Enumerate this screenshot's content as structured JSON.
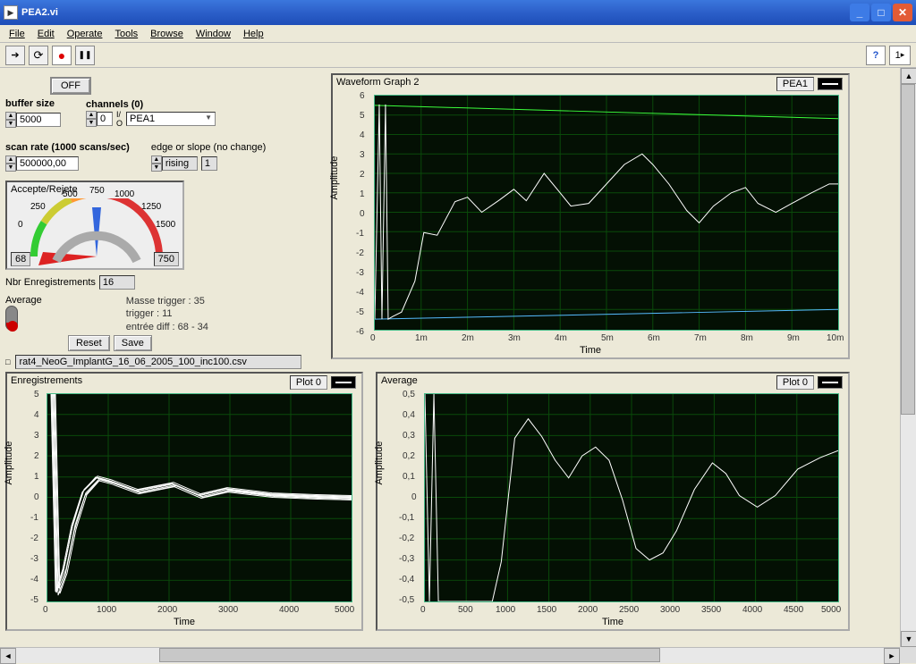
{
  "window": {
    "title": "PEA2.vi"
  },
  "menu": [
    "File",
    "Edit",
    "Operate",
    "Tools",
    "Browse",
    "Window",
    "Help"
  ],
  "toolbar": {
    "context_help": "?",
    "ctx_val": "1"
  },
  "controls": {
    "off_label": "OFF",
    "buffer_size_label": "buffer size",
    "buffer_size": "5000",
    "channels_label": "channels (0)",
    "channels_idx": "0",
    "channels_sel": "PEA1",
    "scan_rate_label": "scan rate (1000 scans/sec)",
    "scan_rate": "500000,00",
    "edge_label": "edge or slope (no change)",
    "edge_sel": "rising",
    "edge_val": "1",
    "gauge_title": "Accepte/Rejete",
    "gauge_ticks": [
      "0",
      "250",
      "500",
      "750",
      "1000",
      "1250",
      "1500"
    ],
    "gauge_left": "68",
    "gauge_right": "750",
    "nbr_label": "Nbr Enregistrements",
    "nbr_val": "16",
    "average_label": "Average",
    "reset_label": "Reset",
    "save_label": "Save",
    "info1": "Masse trigger : 35",
    "info2": "trigger : 11",
    "info3": "entrée diff : 68 - 34",
    "path": "rat4_NeoG_ImplantG_16_06_2005_100_inc100.csv"
  },
  "chart1": {
    "title": "Waveform Graph 2",
    "legend": "PEA1",
    "ylabel": "Amplitude",
    "xlabel": "Time",
    "yticks": [
      "6",
      "5",
      "4",
      "3",
      "2",
      "1",
      "0",
      "-1",
      "-2",
      "-3",
      "-4",
      "-5",
      "-6"
    ],
    "xticks": [
      "0",
      "1m",
      "2m",
      "3m",
      "4m",
      "5m",
      "6m",
      "7m",
      "8m",
      "9m",
      "10m"
    ]
  },
  "chart2": {
    "title": "Enregistrements",
    "legend": "Plot 0",
    "ylabel": "Amplitude",
    "xlabel": "Time",
    "yticks": [
      "5",
      "4",
      "3",
      "2",
      "1",
      "0",
      "-1",
      "-2",
      "-3",
      "-4",
      "-5"
    ],
    "xticks": [
      "0",
      "1000",
      "2000",
      "3000",
      "4000",
      "5000"
    ]
  },
  "chart3": {
    "title": "Average",
    "legend": "Plot 0",
    "ylabel": "Amplitude",
    "xlabel": "Time",
    "yticks": [
      "0,5",
      "0,4",
      "0,3",
      "0,2",
      "0,1",
      "0",
      "-0,1",
      "-0,2",
      "-0,3",
      "-0,4",
      "-0,5"
    ],
    "xticks": [
      "0",
      "500",
      "1000",
      "1500",
      "2000",
      "2500",
      "3000",
      "3500",
      "4000",
      "4500",
      "5000"
    ]
  },
  "chart_data": [
    {
      "type": "line",
      "title": "Waveform Graph 2 — PEA1",
      "xlabel": "Time",
      "ylabel": "Amplitude",
      "xlim": [
        "0",
        "10m"
      ],
      "ylim": [
        -6,
        6
      ],
      "series": [
        {
          "name": "PEA1-white",
          "x": [
            0,
            0.3,
            0.5,
            0.8,
            1.0,
            1.3,
            1.7,
            2.0,
            2.3,
            2.7,
            3.0,
            3.3,
            3.7,
            4.0,
            4.3,
            4.7,
            5.0,
            5.3,
            5.7,
            6.0,
            6.3,
            6.7,
            7.0,
            7.3,
            7.7,
            8.0,
            8.3,
            8.7,
            9.0,
            9.3,
            9.7,
            10.0
          ],
          "y": [
            -5.5,
            -5.3,
            -5.0,
            -3.5,
            -1.0,
            -1.0,
            0.5,
            0.8,
            0.0,
            0.6,
            1.2,
            0.6,
            2.0,
            1.0,
            0.3,
            0.5,
            1.5,
            2.5,
            3.0,
            2.5,
            1.5,
            0.1,
            -0.5,
            0.3,
            1.0,
            1.3,
            0.5,
            0.0,
            0.5,
            1.0,
            1.2,
            1.5
          ]
        },
        {
          "name": "green",
          "x": [
            0,
            10
          ],
          "y": [
            5.5,
            4.8
          ]
        },
        {
          "name": "blue",
          "x": [
            0,
            10
          ],
          "y": [
            -5.5,
            -5.0
          ]
        }
      ]
    },
    {
      "type": "line",
      "title": "Enregistrements (16 overlaid recordings)",
      "xlabel": "Time",
      "ylabel": "Amplitude",
      "xlim": [
        0,
        5000
      ],
      "ylim": [
        -5,
        5
      ],
      "series": [
        {
          "name": "Plot 0 (representative)",
          "x": [
            0,
            100,
            200,
            300,
            400,
            600,
            800,
            1000,
            1500,
            2000,
            2500,
            3000,
            4000,
            5000
          ],
          "y": [
            5,
            -4.5,
            -4.0,
            -2.0,
            0.0,
            0.8,
            1.0,
            0.8,
            0.3,
            0.7,
            0.4,
            0.2,
            0.1,
            0.1
          ]
        }
      ],
      "note": "16 similar traces overlaid in multiple colors"
    },
    {
      "type": "line",
      "title": "Average",
      "xlabel": "Time",
      "ylabel": "Amplitude",
      "xlim": [
        0,
        5000
      ],
      "ylim": [
        -0.5,
        0.5
      ],
      "series": [
        {
          "name": "Plot 0",
          "x": [
            0,
            200,
            400,
            700,
            900,
            1100,
            1300,
            1500,
            1800,
            2000,
            2300,
            2500,
            2700,
            3000,
            3300,
            3500,
            3800,
            4000,
            4300,
            4500,
            4800,
            5000
          ],
          "y": [
            0.5,
            -0.5,
            -0.5,
            -0.5,
            -0.3,
            0.3,
            0.38,
            0.3,
            0.1,
            0.22,
            0.25,
            0.0,
            -0.25,
            -0.3,
            -0.15,
            0.05,
            0.18,
            0.12,
            -0.05,
            0.0,
            0.15,
            0.23
          ]
        }
      ]
    }
  ]
}
